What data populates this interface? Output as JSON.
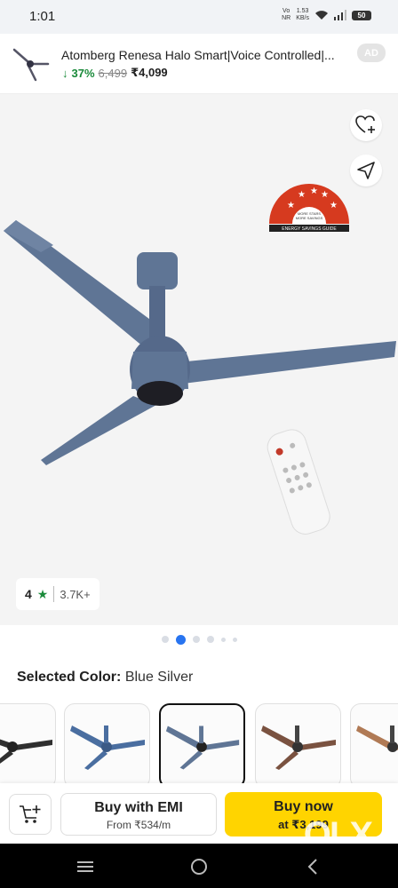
{
  "status_bar": {
    "time": "1:01",
    "network_top": "Vo",
    "network_bottom": "NR",
    "speed_value": "1.53",
    "speed_unit": "KB/s",
    "battery": "50"
  },
  "ad": {
    "title": "Atomberg Renesa Halo Smart|Voice Controlled|...",
    "discount": "37%",
    "mrp": "6,499",
    "price": "₹4,099",
    "badge": "AD"
  },
  "gallery": {
    "rating_value": "4",
    "rating_count": "3.7K+",
    "energy_label_line1": "MORE STARS",
    "energy_label_line2": "MORE SAVINGS",
    "energy_label_caption": "ENERGY SAVINGS GUIDE",
    "pagination": {
      "total": 6,
      "active": 1
    }
  },
  "colors": {
    "label": "Selected Color:",
    "value": "Blue Silver",
    "swatches": [
      {
        "name": "Black",
        "color": "#2f2f2f"
      },
      {
        "name": "Blue",
        "color": "#4a6ea0"
      },
      {
        "name": "Blue Silver",
        "color": "#5f7595",
        "selected": true
      },
      {
        "name": "Brown",
        "color": "#7a5240"
      },
      {
        "name": "Wood",
        "color": "#b07a55"
      }
    ]
  },
  "actions": {
    "emi_title": "Buy with EMI",
    "emi_sub": "From ₹534/m",
    "buy_title": "Buy now",
    "buy_sub": "at ₹3,199"
  },
  "watermark": "OLX",
  "theme": {
    "accent": "#2874f0",
    "buy_yellow": "#ffd400",
    "discount_green": "#1a8a3a",
    "fan_blue": "#5f7595"
  }
}
